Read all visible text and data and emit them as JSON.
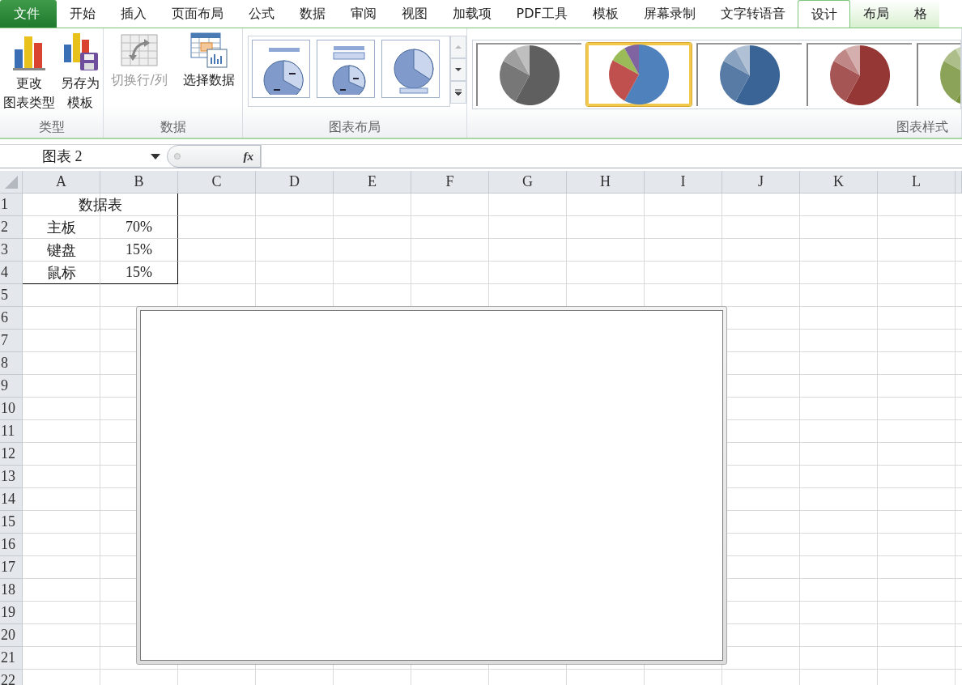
{
  "tabs": [
    {
      "label": "文件",
      "kind": "file",
      "selected": false,
      "contextual": false
    },
    {
      "label": "开始",
      "kind": "tab",
      "selected": false,
      "contextual": false
    },
    {
      "label": "插入",
      "kind": "tab",
      "selected": false,
      "contextual": false
    },
    {
      "label": "页面布局",
      "kind": "tab",
      "selected": false,
      "contextual": false
    },
    {
      "label": "公式",
      "kind": "tab",
      "selected": false,
      "contextual": false
    },
    {
      "label": "数据",
      "kind": "tab",
      "selected": false,
      "contextual": false
    },
    {
      "label": "审阅",
      "kind": "tab",
      "selected": false,
      "contextual": false
    },
    {
      "label": "视图",
      "kind": "tab",
      "selected": false,
      "contextual": false
    },
    {
      "label": "加载项",
      "kind": "tab",
      "selected": false,
      "contextual": false
    },
    {
      "label": "PDF工具",
      "kind": "tab",
      "selected": false,
      "contextual": false
    },
    {
      "label": "模板",
      "kind": "tab",
      "selected": false,
      "contextual": false
    },
    {
      "label": "屏幕录制",
      "kind": "tab",
      "selected": false,
      "contextual": false
    },
    {
      "label": "文字转语音",
      "kind": "tab",
      "selected": false,
      "contextual": false
    },
    {
      "label": "设计",
      "kind": "tab",
      "selected": true,
      "contextual": true
    },
    {
      "label": "布局",
      "kind": "tab",
      "selected": false,
      "contextual": true
    },
    {
      "label": "格",
      "kind": "tab",
      "selected": false,
      "contextual": true
    }
  ],
  "ribbon": {
    "groups": [
      {
        "label": "类型",
        "kind": "buttons",
        "buttons": [
          {
            "lines": [
              "更改",
              "图表类型"
            ],
            "kind": "change_type",
            "disabled": false
          },
          {
            "lines": [
              "另存为",
              "模板"
            ],
            "kind": "save_template",
            "disabled": false
          }
        ]
      },
      {
        "label": "数据",
        "kind": "buttons",
        "buttons": [
          {
            "lines": [
              "切换行/列"
            ],
            "kind": "switch",
            "disabled": true
          },
          {
            "lines": [
              "选择数据"
            ],
            "kind": "select_data",
            "disabled": false
          }
        ]
      },
      {
        "label": "图表布局",
        "kind": "layouts",
        "items": [
          {
            "kind": "title_labels",
            "selected": false
          },
          {
            "kind": "legend_top",
            "selected": false
          },
          {
            "kind": "legend_bottom",
            "selected": false
          }
        ]
      },
      {
        "label": "图表样式",
        "kind": "styles",
        "items": [
          {
            "kind": "mono",
            "color": "#5f5f5f",
            "selected": false
          },
          {
            "kind": "multi",
            "color": "#4f81bd",
            "selected": true
          },
          {
            "kind": "mono",
            "color": "#3a6495",
            "selected": false
          },
          {
            "kind": "mono",
            "color": "#953735",
            "selected": false
          },
          {
            "kind": "mono",
            "color": "#77933c",
            "selected": false
          }
        ]
      }
    ]
  },
  "formula_bar": {
    "name_box": "图表 2",
    "function_button": "fx"
  },
  "sheet": {
    "columns": [
      "A",
      "B",
      "C",
      "D",
      "E",
      "F",
      "G",
      "H",
      "I",
      "J",
      "K",
      "L"
    ],
    "rows": [
      "1",
      "2",
      "3",
      "4",
      "5",
      "6",
      "7",
      "8",
      "9",
      "10",
      "11",
      "12",
      "13",
      "14",
      "15",
      "16",
      "17",
      "18",
      "19",
      "20",
      "21",
      "22"
    ],
    "data_table": {
      "title": "数据表",
      "rows": [
        {
          "label": "主板",
          "value": "70%"
        },
        {
          "label": "键盘",
          "value": "15%"
        },
        {
          "label": "鼠标",
          "value": "15%"
        }
      ]
    },
    "chart_object": {
      "selected": true
    }
  }
}
